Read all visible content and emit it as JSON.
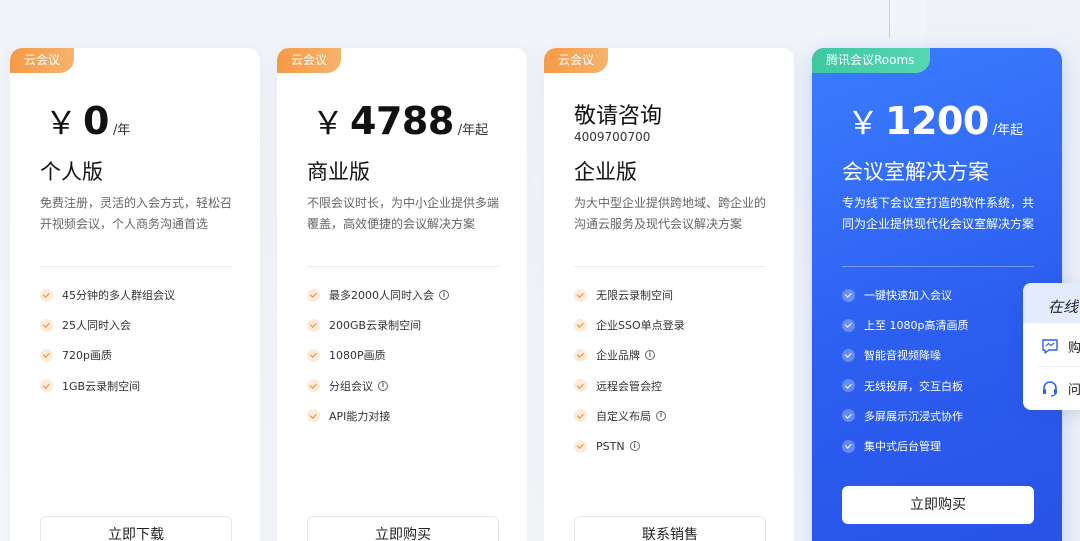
{
  "cards": [
    {
      "badge": "云会议",
      "price": {
        "yen": "￥",
        "amount": "0",
        "unit": "/年"
      },
      "name": "个人版",
      "description": "免费注册，灵活的入会方式，轻松召开视频会议，个人商务沟通首选",
      "features": [
        {
          "text": "45分钟的多人群组会议",
          "info": false
        },
        {
          "text": "25人同时入会",
          "info": false
        },
        {
          "text": "720p画质",
          "info": false
        },
        {
          "text": "1GB云录制空间",
          "info": false
        }
      ],
      "button": "立即下载"
    },
    {
      "badge": "云会议",
      "price": {
        "yen": "￥",
        "amount": "4788",
        "unit": "/年起"
      },
      "name": "商业版",
      "description": "不限会议时长，为中小企业提供多端覆盖，高效便捷的会议解决方案",
      "features": [
        {
          "text": "最多2000人同时入会",
          "info": true
        },
        {
          "text": "200GB云录制空间",
          "info": false
        },
        {
          "text": "1080P画质",
          "info": false
        },
        {
          "text": "分组会议",
          "info": true
        },
        {
          "text": "API能力对接",
          "info": false
        }
      ],
      "button": "立即购买"
    },
    {
      "badge": "云会议",
      "consult": "敬请咨询",
      "phone": "4009700700",
      "name": "企业版",
      "description": "为大中型企业提供跨地域、跨企业的沟通云服务及现代会议解决方案",
      "features": [
        {
          "text": "无限云录制空间",
          "info": false
        },
        {
          "text": "企业SSO单点登录",
          "info": false
        },
        {
          "text": "企业品牌",
          "info": true
        },
        {
          "text": "远程会管会控",
          "info": false
        },
        {
          "text": "自定义布局",
          "info": true
        },
        {
          "text": "PSTN",
          "info": true
        }
      ],
      "button": "联系销售"
    },
    {
      "badge": "腾讯会议Rooms",
      "price": {
        "yen": "￥",
        "amount": "1200",
        "unit": "/年起"
      },
      "name": "会议室解决方案",
      "description": "专为线下会议室打造的软件系统，共同为企业提供现代化会议室解决方案",
      "features": [
        {
          "text": "一键快速加入会议",
          "info": false
        },
        {
          "text": "上至 1080p高清画质",
          "info": false
        },
        {
          "text": "智能音视频降噪",
          "info": false
        },
        {
          "text": "无线投屏，交互白板",
          "info": false
        },
        {
          "text": "多屏展示沉浸式协作",
          "info": false
        },
        {
          "text": "集中式后台管理",
          "info": false
        }
      ],
      "button": "立即购买"
    }
  ],
  "side_widget": {
    "title": "在线",
    "items": [
      {
        "icon": "chat-icon",
        "label": "购"
      },
      {
        "icon": "headset-icon",
        "label": "问"
      }
    ]
  },
  "colors": {
    "accent_orange": "#f59a46",
    "rooms_blue": "#2c5ef0",
    "rooms_badge_green": "#3ec7a0"
  }
}
